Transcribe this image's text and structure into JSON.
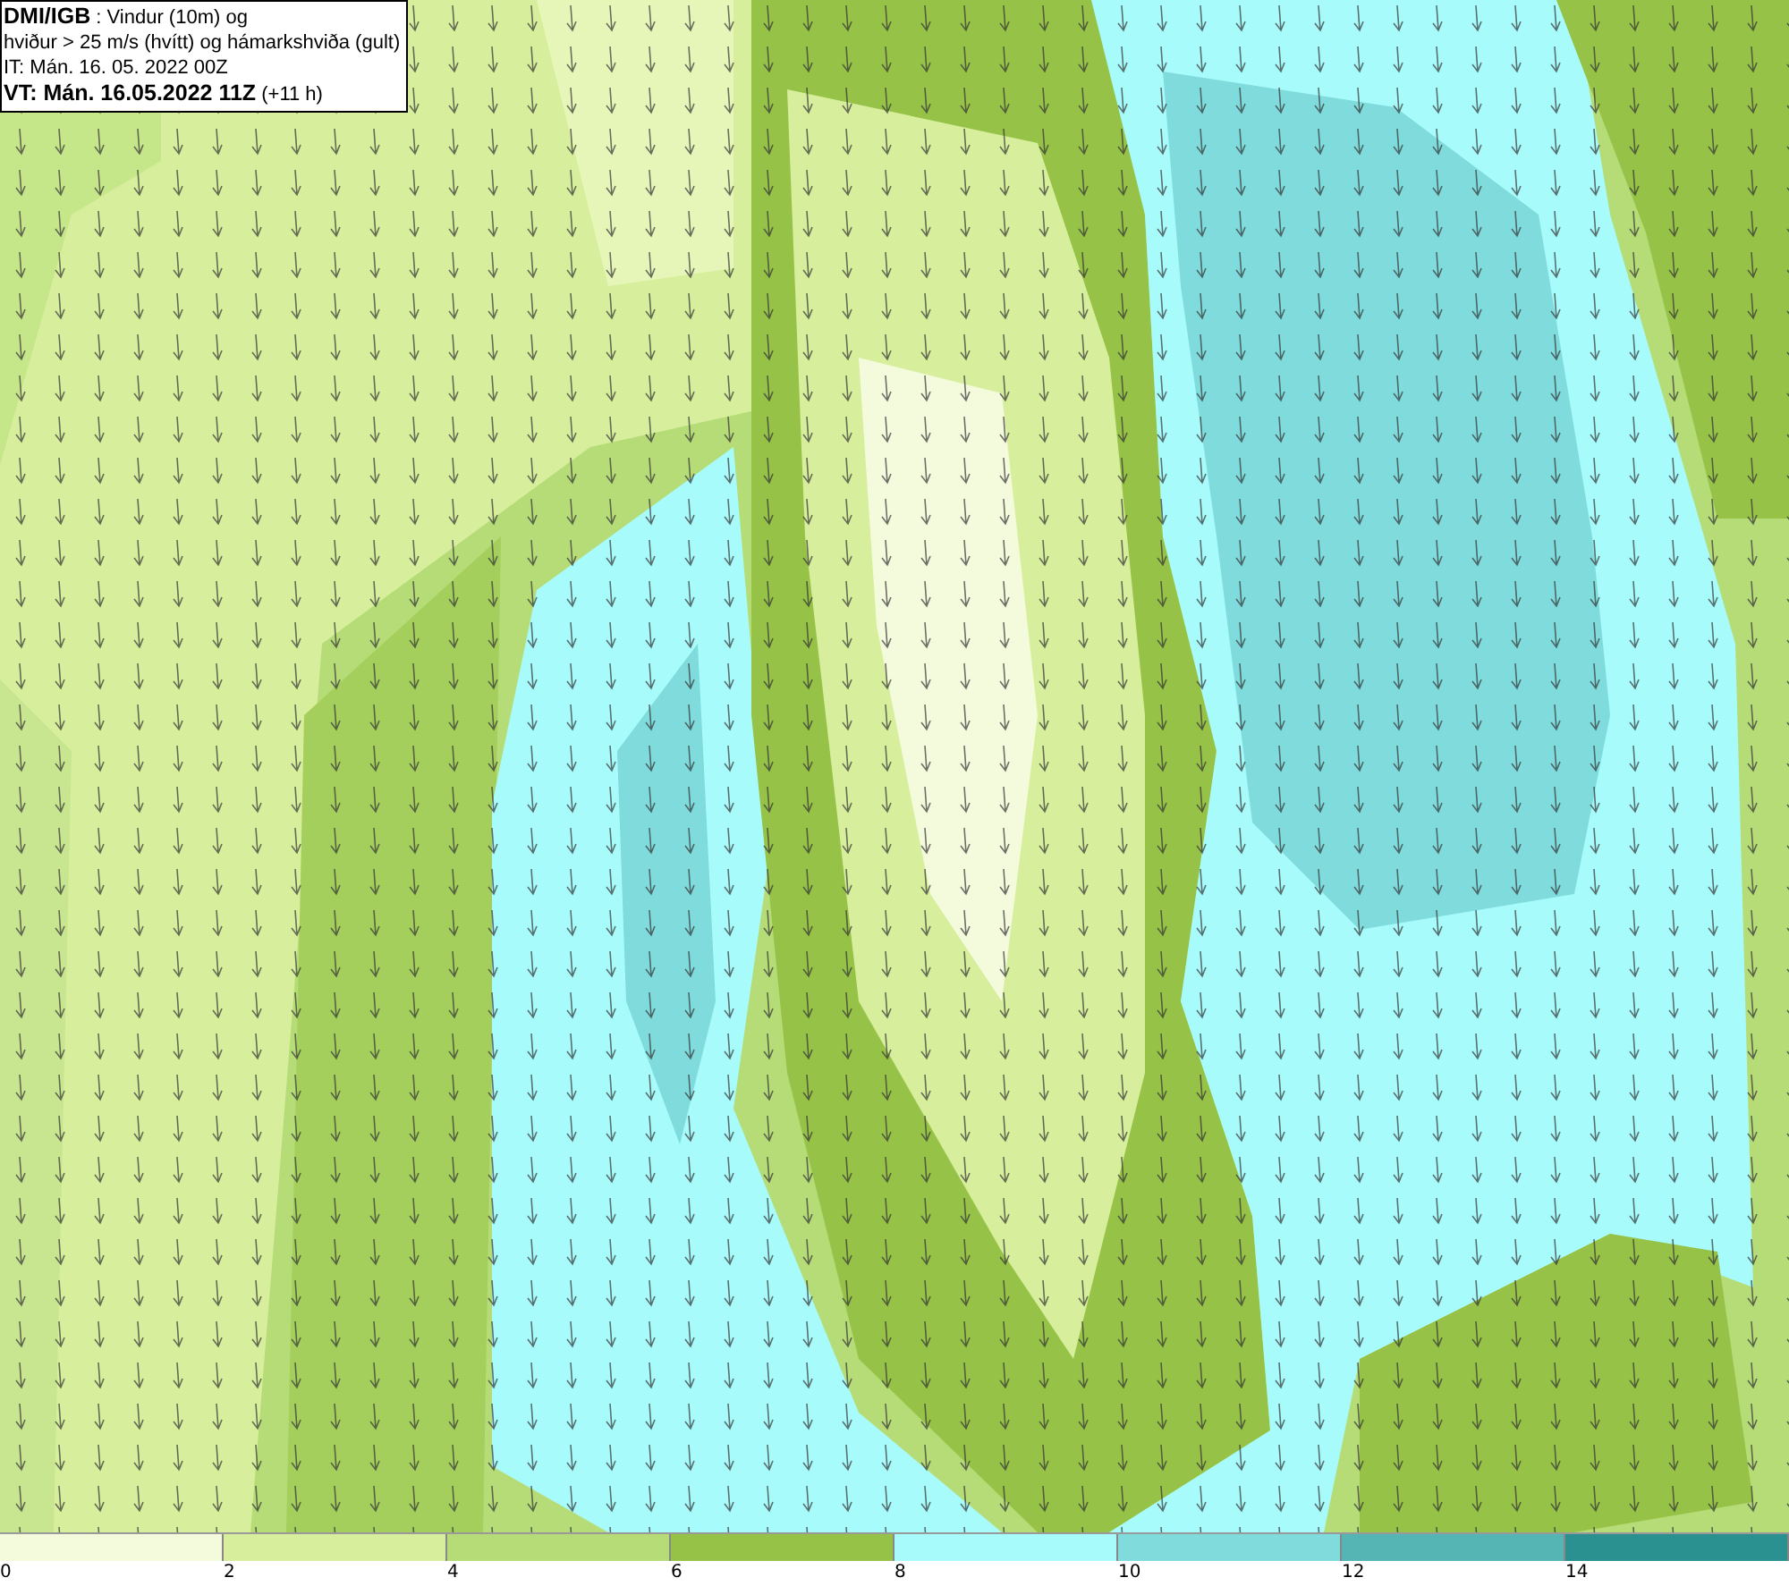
{
  "title_box": {
    "lines": [
      "**DMI/IGB** : Vindur (10m) og",
      "hviður > 25 m/s (hvítt) og hámarkshviða (gult)",
      "IT: Mán. 16. 05. 2022 00Z",
      "**VT: Mán. 16.05.2022 11Z** (+11 h)"
    ]
  },
  "legend": {
    "bins": [
      {
        "color": "#f3fbdc"
      },
      {
        "color": "#d7ef9c"
      },
      {
        "color": "#b6dc78"
      },
      {
        "color": "#96c347"
      },
      {
        "color": "#a8fbfb"
      },
      {
        "color": "#80dcdc"
      },
      {
        "color": "#55b4b4"
      },
      {
        "color": "#2a9090"
      }
    ],
    "ticks": [
      "0",
      "2",
      "4",
      "6",
      "8",
      "10",
      "12",
      "14"
    ]
  }
}
